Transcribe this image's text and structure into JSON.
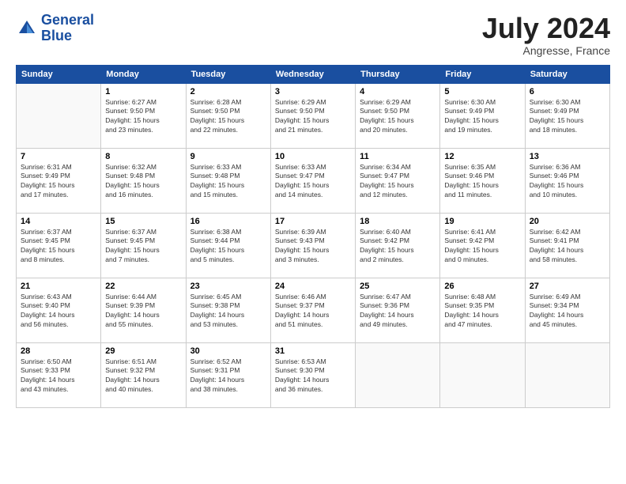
{
  "header": {
    "logo_line1": "General",
    "logo_line2": "Blue",
    "month_title": "July 2024",
    "location": "Angresse, France"
  },
  "calendar": {
    "days_of_week": [
      "Sunday",
      "Monday",
      "Tuesday",
      "Wednesday",
      "Thursday",
      "Friday",
      "Saturday"
    ],
    "weeks": [
      [
        {
          "day": "",
          "info": ""
        },
        {
          "day": "1",
          "info": "Sunrise: 6:27 AM\nSunset: 9:50 PM\nDaylight: 15 hours\nand 23 minutes."
        },
        {
          "day": "2",
          "info": "Sunrise: 6:28 AM\nSunset: 9:50 PM\nDaylight: 15 hours\nand 22 minutes."
        },
        {
          "day": "3",
          "info": "Sunrise: 6:29 AM\nSunset: 9:50 PM\nDaylight: 15 hours\nand 21 minutes."
        },
        {
          "day": "4",
          "info": "Sunrise: 6:29 AM\nSunset: 9:50 PM\nDaylight: 15 hours\nand 20 minutes."
        },
        {
          "day": "5",
          "info": "Sunrise: 6:30 AM\nSunset: 9:49 PM\nDaylight: 15 hours\nand 19 minutes."
        },
        {
          "day": "6",
          "info": "Sunrise: 6:30 AM\nSunset: 9:49 PM\nDaylight: 15 hours\nand 18 minutes."
        }
      ],
      [
        {
          "day": "7",
          "info": "Sunrise: 6:31 AM\nSunset: 9:49 PM\nDaylight: 15 hours\nand 17 minutes."
        },
        {
          "day": "8",
          "info": "Sunrise: 6:32 AM\nSunset: 9:48 PM\nDaylight: 15 hours\nand 16 minutes."
        },
        {
          "day": "9",
          "info": "Sunrise: 6:33 AM\nSunset: 9:48 PM\nDaylight: 15 hours\nand 15 minutes."
        },
        {
          "day": "10",
          "info": "Sunrise: 6:33 AM\nSunset: 9:47 PM\nDaylight: 15 hours\nand 14 minutes."
        },
        {
          "day": "11",
          "info": "Sunrise: 6:34 AM\nSunset: 9:47 PM\nDaylight: 15 hours\nand 12 minutes."
        },
        {
          "day": "12",
          "info": "Sunrise: 6:35 AM\nSunset: 9:46 PM\nDaylight: 15 hours\nand 11 minutes."
        },
        {
          "day": "13",
          "info": "Sunrise: 6:36 AM\nSunset: 9:46 PM\nDaylight: 15 hours\nand 10 minutes."
        }
      ],
      [
        {
          "day": "14",
          "info": "Sunrise: 6:37 AM\nSunset: 9:45 PM\nDaylight: 15 hours\nand 8 minutes."
        },
        {
          "day": "15",
          "info": "Sunrise: 6:37 AM\nSunset: 9:45 PM\nDaylight: 15 hours\nand 7 minutes."
        },
        {
          "day": "16",
          "info": "Sunrise: 6:38 AM\nSunset: 9:44 PM\nDaylight: 15 hours\nand 5 minutes."
        },
        {
          "day": "17",
          "info": "Sunrise: 6:39 AM\nSunset: 9:43 PM\nDaylight: 15 hours\nand 3 minutes."
        },
        {
          "day": "18",
          "info": "Sunrise: 6:40 AM\nSunset: 9:42 PM\nDaylight: 15 hours\nand 2 minutes."
        },
        {
          "day": "19",
          "info": "Sunrise: 6:41 AM\nSunset: 9:42 PM\nDaylight: 15 hours\nand 0 minutes."
        },
        {
          "day": "20",
          "info": "Sunrise: 6:42 AM\nSunset: 9:41 PM\nDaylight: 14 hours\nand 58 minutes."
        }
      ],
      [
        {
          "day": "21",
          "info": "Sunrise: 6:43 AM\nSunset: 9:40 PM\nDaylight: 14 hours\nand 56 minutes."
        },
        {
          "day": "22",
          "info": "Sunrise: 6:44 AM\nSunset: 9:39 PM\nDaylight: 14 hours\nand 55 minutes."
        },
        {
          "day": "23",
          "info": "Sunrise: 6:45 AM\nSunset: 9:38 PM\nDaylight: 14 hours\nand 53 minutes."
        },
        {
          "day": "24",
          "info": "Sunrise: 6:46 AM\nSunset: 9:37 PM\nDaylight: 14 hours\nand 51 minutes."
        },
        {
          "day": "25",
          "info": "Sunrise: 6:47 AM\nSunset: 9:36 PM\nDaylight: 14 hours\nand 49 minutes."
        },
        {
          "day": "26",
          "info": "Sunrise: 6:48 AM\nSunset: 9:35 PM\nDaylight: 14 hours\nand 47 minutes."
        },
        {
          "day": "27",
          "info": "Sunrise: 6:49 AM\nSunset: 9:34 PM\nDaylight: 14 hours\nand 45 minutes."
        }
      ],
      [
        {
          "day": "28",
          "info": "Sunrise: 6:50 AM\nSunset: 9:33 PM\nDaylight: 14 hours\nand 43 minutes."
        },
        {
          "day": "29",
          "info": "Sunrise: 6:51 AM\nSunset: 9:32 PM\nDaylight: 14 hours\nand 40 minutes."
        },
        {
          "day": "30",
          "info": "Sunrise: 6:52 AM\nSunset: 9:31 PM\nDaylight: 14 hours\nand 38 minutes."
        },
        {
          "day": "31",
          "info": "Sunrise: 6:53 AM\nSunset: 9:30 PM\nDaylight: 14 hours\nand 36 minutes."
        },
        {
          "day": "",
          "info": ""
        },
        {
          "day": "",
          "info": ""
        },
        {
          "day": "",
          "info": ""
        }
      ]
    ]
  }
}
